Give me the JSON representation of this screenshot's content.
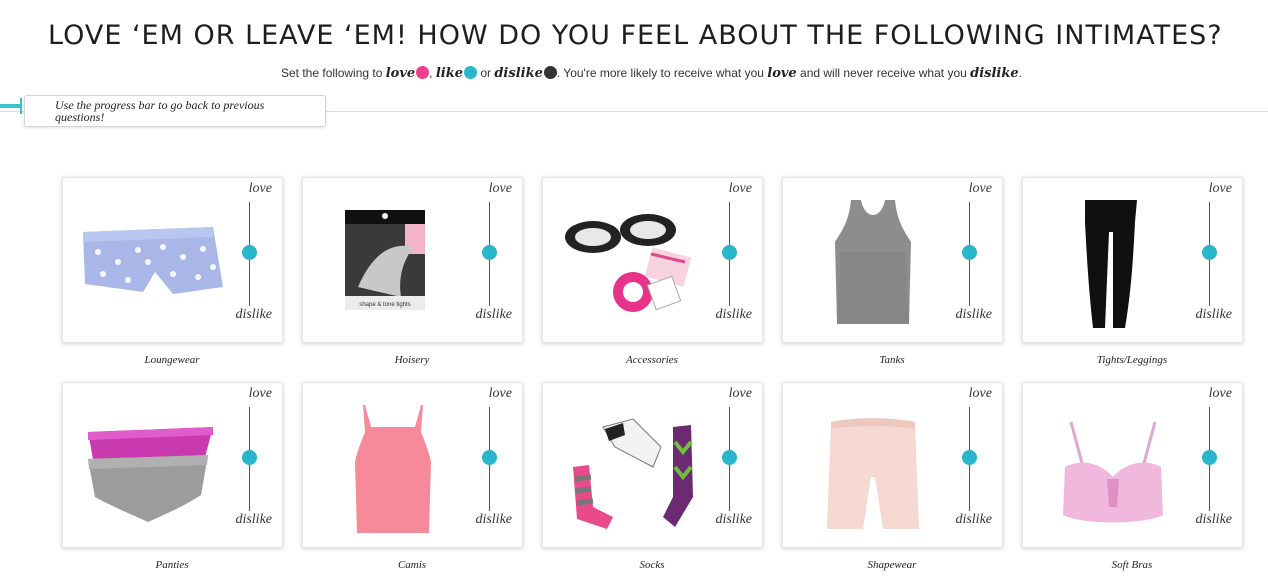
{
  "header": {
    "title": "LOVE ‘EM OR LEAVE ‘EM! HOW DO YOU FEEL ABOUT THE FOLLOWING INTIMATES?",
    "instruction_prefix": "Set the following to ",
    "love_word": "love",
    "comma": ", ",
    "like_word": "like",
    "or_word": " or ",
    "dislike_word": "dislike",
    "instruction_middle": ". You're more likely to receive what you ",
    "love_word_2": "love",
    "instruction_end": " and will never receive what you ",
    "dislike_word_2": "dislike",
    "period": "."
  },
  "colors": {
    "love": "#f0408a",
    "like": "#29b6cc",
    "dislike": "#333333",
    "accent": "#3cc3d2"
  },
  "progress_hint": "Use the progress bar to go back to previous questions!",
  "slider_labels": {
    "top": "love",
    "bottom": "dislike"
  },
  "items": [
    {
      "label": "Loungewear",
      "value": "like",
      "icon": "shorts-image"
    },
    {
      "label": "Hoisery",
      "value": "like",
      "icon": "tights-package-image"
    },
    {
      "label": "Accessories",
      "value": "like",
      "icon": "accessories-image"
    },
    {
      "label": "Tanks",
      "value": "like",
      "icon": "tank-top-image"
    },
    {
      "label": "Tights/Leggings",
      "value": "like",
      "icon": "leggings-image"
    },
    {
      "label": "Panties",
      "value": "like",
      "icon": "panties-image"
    },
    {
      "label": "Camis",
      "value": "like",
      "icon": "cami-image"
    },
    {
      "label": "Socks",
      "value": "like",
      "icon": "socks-image"
    },
    {
      "label": "Shapewear",
      "value": "like",
      "icon": "shapewear-image"
    },
    {
      "label": "Soft Bras",
      "value": "like",
      "icon": "bra-image"
    }
  ]
}
